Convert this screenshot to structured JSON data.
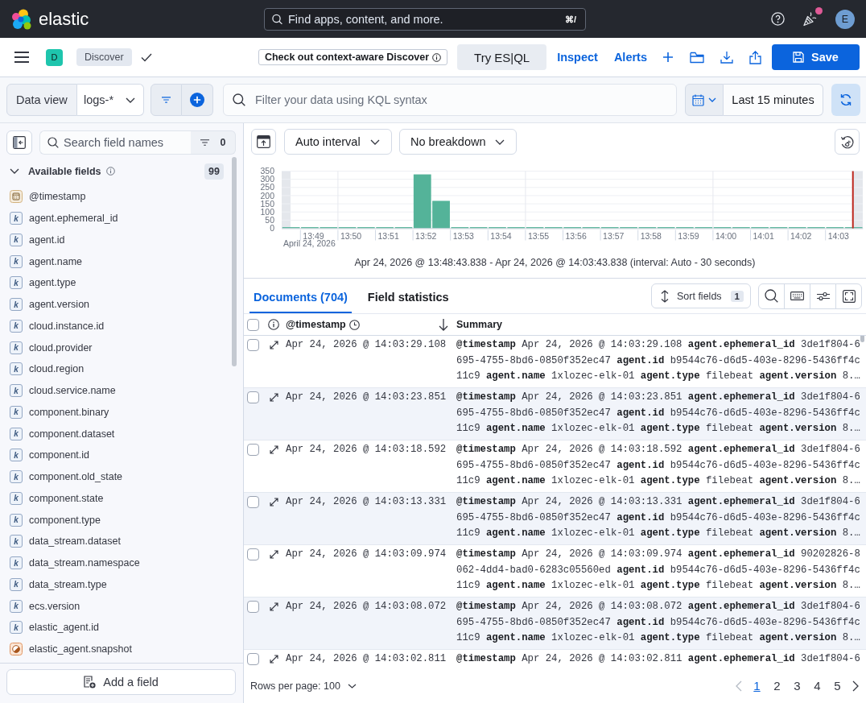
{
  "header": {
    "logo_text": "elastic",
    "search_placeholder": "Find apps, content, and more.",
    "search_shortcut": "⌘/",
    "news_unread": true,
    "avatar_initial": "E"
  },
  "app_bar": {
    "space_initial": "D",
    "breadcrumb": "Discover",
    "callout": "Check out context-aware Discover",
    "esql_button": "Try ES|QL",
    "links": [
      "Inspect",
      "Alerts"
    ],
    "save_button": "Save"
  },
  "query_bar": {
    "data_view_label": "Data view",
    "data_view": "logs-*",
    "placeholder": "Filter your data using KQL syntax",
    "time_range": "Last 15 minutes"
  },
  "sidebar": {
    "search_placeholder": "Search field names",
    "filter_count": "0",
    "section": {
      "title": "Available fields",
      "count": "99",
      "expanded": true,
      "fields": [
        {
          "name": "@timestamp",
          "kind": "date"
        },
        {
          "name": "agent.ephemeral_id",
          "kind": "keyword",
          "token": "k"
        },
        {
          "name": "agent.id",
          "kind": "keyword",
          "token": "k"
        },
        {
          "name": "agent.name",
          "kind": "keyword",
          "token": "k"
        },
        {
          "name": "agent.type",
          "kind": "keyword",
          "token": "k"
        },
        {
          "name": "agent.version",
          "kind": "keyword",
          "token": "k"
        },
        {
          "name": "cloud.instance.id",
          "kind": "keyword",
          "token": "k"
        },
        {
          "name": "cloud.provider",
          "kind": "keyword",
          "token": "k"
        },
        {
          "name": "cloud.region",
          "kind": "keyword",
          "token": "k"
        },
        {
          "name": "cloud.service.name",
          "kind": "keyword",
          "token": "k"
        },
        {
          "name": "component.binary",
          "kind": "keyword",
          "token": "k"
        },
        {
          "name": "component.dataset",
          "kind": "keyword",
          "token": "k"
        },
        {
          "name": "component.id",
          "kind": "keyword",
          "token": "k"
        },
        {
          "name": "component.old_state",
          "kind": "keyword",
          "token": "k"
        },
        {
          "name": "component.state",
          "kind": "keyword",
          "token": "k"
        },
        {
          "name": "component.type",
          "kind": "keyword",
          "token": "k"
        },
        {
          "name": "data_stream.dataset",
          "kind": "keyword",
          "token": "k"
        },
        {
          "name": "data_stream.namespace",
          "kind": "keyword",
          "token": "k"
        },
        {
          "name": "data_stream.type",
          "kind": "keyword",
          "token": "k"
        },
        {
          "name": "ecs.version",
          "kind": "keyword",
          "token": "k"
        },
        {
          "name": "elastic_agent.id",
          "kind": "keyword",
          "token": "k"
        },
        {
          "name": "elastic_agent.snapshot",
          "kind": "boolean"
        }
      ]
    },
    "add_button": "Add a field"
  },
  "histogram": {
    "interval": "Auto interval",
    "breakdown": "No breakdown",
    "axis_date": "April 24, 2026",
    "chart_data": {
      "type": "bar",
      "categories": [
        null,
        "13:49",
        null,
        "13:50",
        null,
        "13:51",
        null,
        "13:52",
        null,
        "13:53",
        null,
        "13:54",
        null,
        "13:55",
        null,
        "13:56",
        null,
        "13:57",
        null,
        "13:58",
        null,
        "13:59",
        null,
        "14:00",
        null,
        "14:01",
        null,
        "14:02",
        null,
        "14:03",
        null
      ],
      "series": [
        {
          "color": "#54b399",
          "values": [
            7,
            7,
            7,
            7,
            7,
            7,
            7,
            330,
            168,
            7,
            7,
            7,
            7,
            7,
            7,
            7,
            7,
            7,
            7,
            7,
            7,
            7,
            7,
            7,
            7,
            7,
            7,
            7,
            7,
            7,
            7
          ]
        }
      ],
      "ylim": [
        0,
        350
      ],
      "yticks": [
        0,
        50,
        100,
        150,
        200,
        250,
        300,
        350
      ],
      "grid": true
    },
    "caption": "Apr 24, 2026 @ 13:48:43.838 - Apr 24, 2026 @ 14:03:43.838 (interval: Auto - 30 seconds)"
  },
  "documents": {
    "tabs": [
      {
        "label": "Documents (704)",
        "selected": true
      },
      {
        "label": "Field statistics",
        "selected": false
      }
    ],
    "sort_button": "Sort fields",
    "sort_count": "1",
    "select_all_checked": false,
    "columns": [
      "@timestamp",
      "Summary"
    ],
    "rows": [
      {
        "checked": false,
        "timestamp": "Apr 24, 2026 @ 14:03:29.108",
        "summary": [
          {
            "key": "@timestamp",
            "value": "Apr 24, 2026 @ 14:03:29.108"
          },
          {
            "key": "agent.ephemeral_id",
            "value": "3de1f804-6695-4755-8bd6-0850f352ec47"
          },
          {
            "key": "agent.id",
            "value": "b9544c76-d6d5-403e-8296-5436ff4c11c9"
          },
          {
            "key": "agent.name",
            "value": "1xlozec-elk-01"
          },
          {
            "key": "agent.type",
            "value": "filebeat"
          },
          {
            "key": "agent.version",
            "value": "8.…"
          }
        ]
      },
      {
        "checked": false,
        "timestamp": "Apr 24, 2026 @ 14:03:23.851",
        "summary": [
          {
            "key": "@timestamp",
            "value": "Apr 24, 2026 @ 14:03:23.851"
          },
          {
            "key": "agent.ephemeral_id",
            "value": "3de1f804-6695-4755-8bd6-0850f352ec47"
          },
          {
            "key": "agent.id",
            "value": "b9544c76-d6d5-403e-8296-5436ff4c11c9"
          },
          {
            "key": "agent.name",
            "value": "1xlozec-elk-01"
          },
          {
            "key": "agent.type",
            "value": "filebeat"
          },
          {
            "key": "agent.version",
            "value": "8.…"
          }
        ]
      },
      {
        "checked": false,
        "timestamp": "Apr 24, 2026 @ 14:03:18.592",
        "summary": [
          {
            "key": "@timestamp",
            "value": "Apr 24, 2026 @ 14:03:18.592"
          },
          {
            "key": "agent.ephemeral_id",
            "value": "3de1f804-6695-4755-8bd6-0850f352ec47"
          },
          {
            "key": "agent.id",
            "value": "b9544c76-d6d5-403e-8296-5436ff4c11c9"
          },
          {
            "key": "agent.name",
            "value": "1xlozec-elk-01"
          },
          {
            "key": "agent.type",
            "value": "filebeat"
          },
          {
            "key": "agent.version",
            "value": "8.…"
          }
        ]
      },
      {
        "checked": false,
        "timestamp": "Apr 24, 2026 @ 14:03:13.331",
        "summary": [
          {
            "key": "@timestamp",
            "value": "Apr 24, 2026 @ 14:03:13.331"
          },
          {
            "key": "agent.ephemeral_id",
            "value": "3de1f804-6695-4755-8bd6-0850f352ec47"
          },
          {
            "key": "agent.id",
            "value": "b9544c76-d6d5-403e-8296-5436ff4c11c9"
          },
          {
            "key": "agent.name",
            "value": "1xlozec-elk-01"
          },
          {
            "key": "agent.type",
            "value": "filebeat"
          },
          {
            "key": "agent.version",
            "value": "8.…"
          }
        ]
      },
      {
        "checked": false,
        "timestamp": "Apr 24, 2026 @ 14:03:09.974",
        "summary": [
          {
            "key": "@timestamp",
            "value": "Apr 24, 2026 @ 14:03:09.974"
          },
          {
            "key": "agent.ephemeral_id",
            "value": "90202826-8062-4dd4-bad0-6283c05560ed"
          },
          {
            "key": "agent.id",
            "value": "b9544c76-d6d5-403e-8296-5436ff4c11c9"
          },
          {
            "key": "agent.name",
            "value": "1xlozec-elk-01"
          },
          {
            "key": "agent.type",
            "value": "filebeat"
          },
          {
            "key": "agent.version",
            "value": "8.…"
          }
        ]
      },
      {
        "checked": false,
        "timestamp": "Apr 24, 2026 @ 14:03:08.072",
        "summary": [
          {
            "key": "@timestamp",
            "value": "Apr 24, 2026 @ 14:03:08.072"
          },
          {
            "key": "agent.ephemeral_id",
            "value": "3de1f804-6695-4755-8bd6-0850f352ec47"
          },
          {
            "key": "agent.id",
            "value": "b9544c76-d6d5-403e-8296-5436ff4c11c9"
          },
          {
            "key": "agent.name",
            "value": "1xlozec-elk-01"
          },
          {
            "key": "agent.type",
            "value": "filebeat"
          },
          {
            "key": "agent.version",
            "value": "8.…"
          }
        ]
      },
      {
        "checked": false,
        "timestamp": "Apr 24, 2026 @ 14:03:02.811",
        "summary": [
          {
            "key": "@timestamp",
            "value": "Apr 24, 2026 @ 14:03:02.811"
          },
          {
            "key": "agent.ephemeral_id",
            "value": "3de1f804-6"
          }
        ]
      }
    ]
  },
  "footer": {
    "rows_per_page": "Rows per page: 100",
    "pages": [
      {
        "label": "1",
        "selected": true
      },
      {
        "label": "2",
        "selected": false
      },
      {
        "label": "3",
        "selected": false
      },
      {
        "label": "4",
        "selected": false
      },
      {
        "label": "5",
        "selected": false
      }
    ],
    "prev_disabled": true,
    "next_disabled": false
  }
}
